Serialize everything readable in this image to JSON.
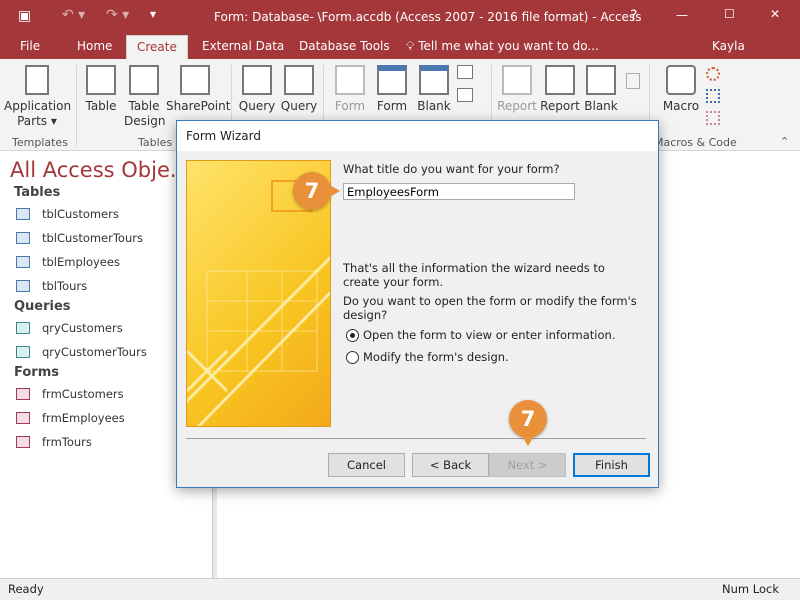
{
  "window": {
    "title": "Form: Database- \\Form.accdb (Access 2007 - 2016 file format) - Access",
    "help": "?",
    "minimize": "—",
    "maximize": "☐",
    "close": "✕"
  },
  "tabs": {
    "items": [
      "File",
      "Home",
      "Create",
      "External Data",
      "Database Tools"
    ],
    "active": "Create",
    "tell_me": "Tell me what you want to do...",
    "user": "Kayla Claypool"
  },
  "ribbon": {
    "groups": [
      "Templates",
      "Tables",
      "Macros & Code"
    ],
    "buttons": {
      "app_parts": "Application",
      "app_parts2": "Parts",
      "table": "Table",
      "table_design": "Table",
      "table_design2": "Design",
      "sharepoint": "SharePoint",
      "query_wizard": "Query",
      "query_design": "Query",
      "form": "Form",
      "form_design": "Form",
      "blank_form": "Blank",
      "report": "Report",
      "report_design": "Report",
      "blank_report": "Blank",
      "macro": "Macro"
    }
  },
  "nav": {
    "title": "All Access Obje...",
    "sections": [
      {
        "header": "Tables",
        "items": [
          "tblCustomers",
          "tblCustomerTours",
          "tblEmployees",
          "tblTours"
        ]
      },
      {
        "header": "Queries",
        "items": [
          "qryCustomers",
          "qryCustomerTours"
        ]
      },
      {
        "header": "Forms",
        "items": [
          "frmCustomers",
          "frmEmployees",
          "frmTours"
        ]
      }
    ]
  },
  "dialog": {
    "title": "Form Wizard",
    "question": "What title do you want for your form?",
    "title_value": "EmployeesForm",
    "info": "That's all the information the wizard needs to create your form.",
    "open_question": "Do you want to open the form or modify the form's design?",
    "options": [
      {
        "label": "Open the form to view or enter information.",
        "selected": true
      },
      {
        "label": "Modify the form's design.",
        "selected": false
      }
    ],
    "buttons": {
      "cancel": "Cancel",
      "back": "< Back",
      "next": "Next >",
      "finish": "Finish"
    }
  },
  "callouts": [
    "7",
    "7"
  ],
  "callout_color": "#e8903a",
  "accent_color": "#a4373a",
  "status": {
    "left": "Ready",
    "right": "Num Lock"
  }
}
